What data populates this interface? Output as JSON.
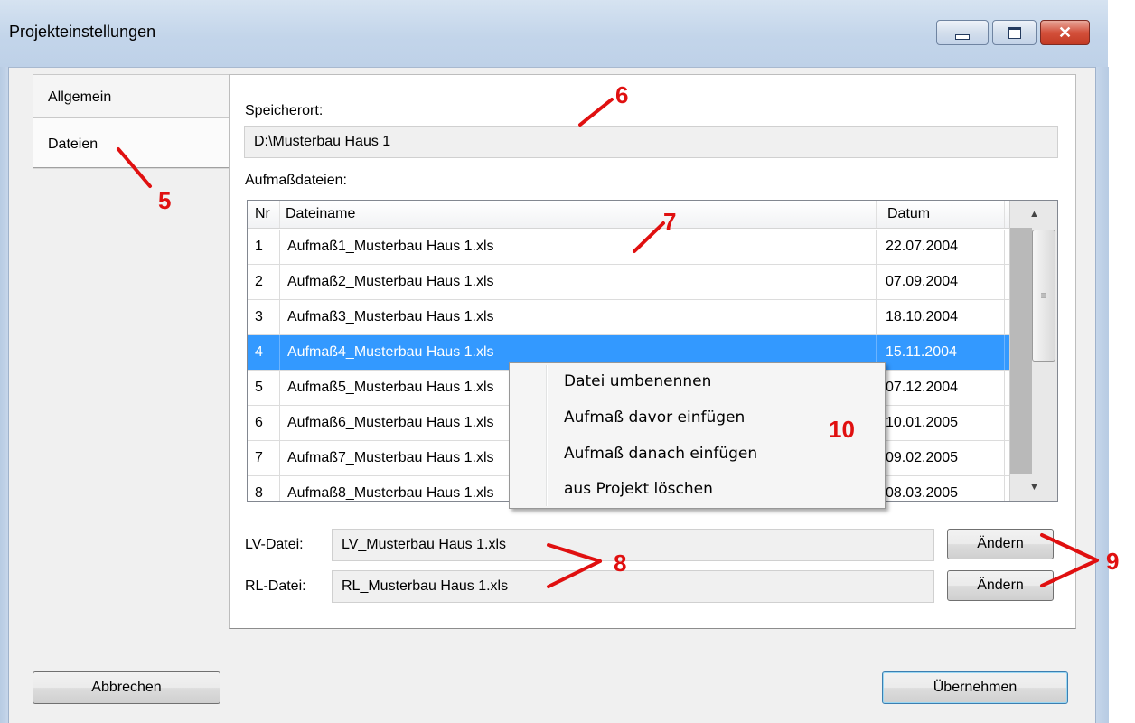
{
  "window": {
    "title": "Projekteinstellungen",
    "close_glyph": "✕"
  },
  "tabs": [
    {
      "label": "Allgemein"
    },
    {
      "label": "Dateien"
    }
  ],
  "storage": {
    "label": "Speicherort:",
    "value": "D:\\Musterbau Haus 1"
  },
  "measure_files": {
    "label": "Aufmaßdateien:",
    "columns": [
      "Nr",
      "Dateiname",
      "Datum"
    ],
    "rows": [
      {
        "nr": "1",
        "name": "Aufmaß1_Musterbau Haus 1.xls",
        "date": "22.07.2004"
      },
      {
        "nr": "2",
        "name": "Aufmaß2_Musterbau Haus 1.xls",
        "date": "07.09.2004"
      },
      {
        "nr": "3",
        "name": "Aufmaß3_Musterbau Haus 1.xls",
        "date": "18.10.2004"
      },
      {
        "nr": "4",
        "name": "Aufmaß4_Musterbau Haus 1.xls",
        "date": "15.11.2004"
      },
      {
        "nr": "5",
        "name": "Aufmaß5_Musterbau Haus 1.xls",
        "date": "07.12.2004"
      },
      {
        "nr": "6",
        "name": "Aufmaß6_Musterbau Haus 1.xls",
        "date": "10.01.2005"
      },
      {
        "nr": "7",
        "name": "Aufmaß7_Musterbau Haus 1.xls",
        "date": "09.02.2005"
      },
      {
        "nr": "8",
        "name": "Aufmaß8_Musterbau Haus 1.xls",
        "date": "08.03.2005"
      }
    ],
    "selected_nr": "4"
  },
  "context_menu": {
    "items": [
      "Datei umbenennen",
      "Aufmaß davor einfügen",
      "Aufmaß danach einfügen",
      "aus Projekt löschen"
    ]
  },
  "lv_file": {
    "label": "LV-Datei:",
    "value": "LV_Musterbau Haus 1.xls",
    "button": "Ändern"
  },
  "rl_file": {
    "label": "RL-Datei:",
    "value": "RL_Musterbau Haus 1.xls",
    "button": "Ändern"
  },
  "footer": {
    "cancel": "Abbrechen",
    "apply": "Übernehmen"
  },
  "annotations": [
    "5",
    "6",
    "7",
    "8",
    "9",
    "10"
  ],
  "colors": {
    "selection": "#3399ff",
    "annotation": "#e01010",
    "close_button": "#c33b24"
  }
}
